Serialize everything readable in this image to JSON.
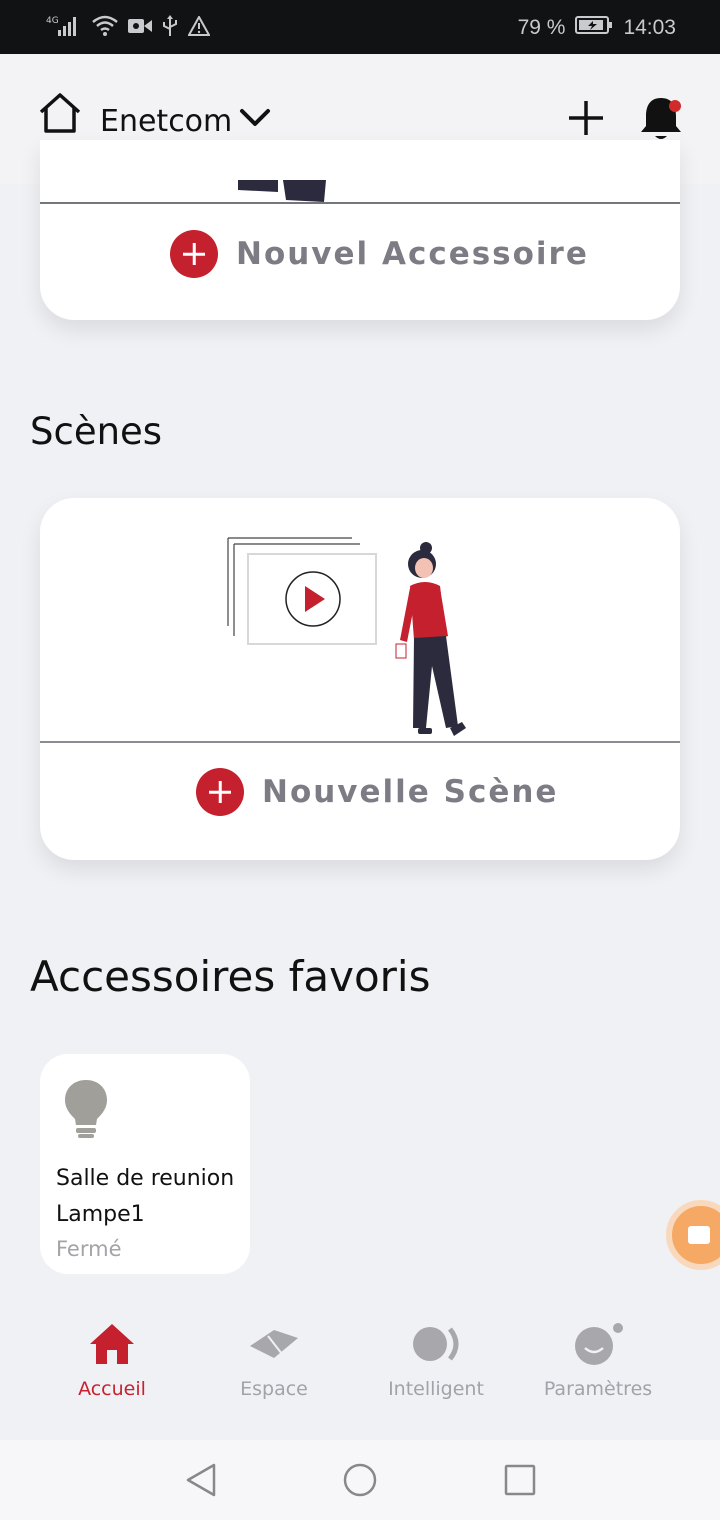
{
  "status_bar": {
    "network": "4G",
    "battery": "79 %",
    "time": "14:03"
  },
  "header": {
    "home_name": "Enetcom"
  },
  "accessories_card": {
    "add_label": "Nouvel Accessoire"
  },
  "scenes": {
    "title": "Scènes",
    "add_label": "Nouvelle Scène"
  },
  "favorites": {
    "title": "Accessoires favoris",
    "items": [
      {
        "room": "Salle de reunion",
        "name": "Lampe1",
        "status": "Fermé",
        "icon": "lightbulb-icon"
      }
    ]
  },
  "tabs": [
    {
      "label": "Accueil",
      "icon": "home-icon",
      "active": true
    },
    {
      "label": "Espace",
      "icon": "space-icon",
      "active": false
    },
    {
      "label": "Intelligent",
      "icon": "smart-icon",
      "active": false
    },
    {
      "label": "Paramètres",
      "icon": "settings-face-icon",
      "active": false
    }
  ],
  "colors": {
    "accent_red": "#c5202e",
    "label_gray": "#7d7c85",
    "background": "#f0f1f5",
    "notification_dot": "#d12a2a"
  }
}
